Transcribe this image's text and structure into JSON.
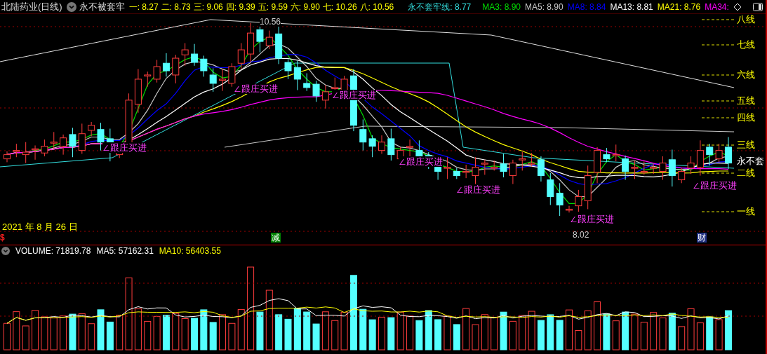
{
  "header": {
    "title": "北陆药业(日线)",
    "indicator": "永不被套牢",
    "levels": [
      {
        "text": "一: 8.27"
      },
      {
        "text": "二: 8.73"
      },
      {
        "text": "三: 9.06"
      },
      {
        "text": "四: 9.39"
      },
      {
        "text": "五: 9.59"
      },
      {
        "text": "六: 9.90"
      },
      {
        "text": "七: 10.26"
      },
      {
        "text": "八: 10.56"
      }
    ],
    "baseline": {
      "text": "永不套牢线: 8.77",
      "color": "#33dddd"
    },
    "moving_averages": [
      {
        "text": "MA3: 8.90",
        "color": "#00dd00"
      },
      {
        "text": "MA5: 8.90",
        "color": "#c8c8c8"
      },
      {
        "text": "MA8: 8.84",
        "color": "#0000ff"
      },
      {
        "text": "MA13: 8.81",
        "color": "#ffffff"
      },
      {
        "text": "MA21: 8.76",
        "color": "#ffff00"
      },
      {
        "text": "MA34:",
        "color": "#ff00ff"
      }
    ]
  },
  "price_chart": {
    "level_lines": [
      {
        "text": "八线"
      },
      {
        "text": "七线"
      },
      {
        "text": "六线"
      },
      {
        "text": "五线"
      },
      {
        "text": "四线"
      },
      {
        "text": "三线"
      },
      {
        "text": "二线"
      },
      {
        "text": "一线"
      }
    ],
    "signals": [
      {
        "text": "∠跟庄买进"
      },
      {
        "text": "∠跟庄买进"
      },
      {
        "text": "∠跟庄买进"
      },
      {
        "text": "∠跟庄买进"
      },
      {
        "text": "∠跟庄买进"
      },
      {
        "text": "∠跟庄买进"
      },
      {
        "text": "∠跟庄买进"
      }
    ],
    "high_label": "10.56",
    "low_label": "8.02",
    "date": "2021 年 8 月 26 日",
    "line_label": "永不套",
    "markers": [
      {
        "text": "$",
        "kind": "dollar"
      },
      {
        "text": "减",
        "kind": "reduce"
      },
      {
        "text": "财",
        "kind": "finance"
      }
    ]
  },
  "volume": {
    "items": [
      {
        "text": "VOLUME: 71819.78",
        "color": "#ffffff"
      },
      {
        "text": "MA5: 57162.31",
        "color": "#ffffff"
      },
      {
        "text": "MA10: 56403.55",
        "color": "#ffff00"
      }
    ]
  }
}
